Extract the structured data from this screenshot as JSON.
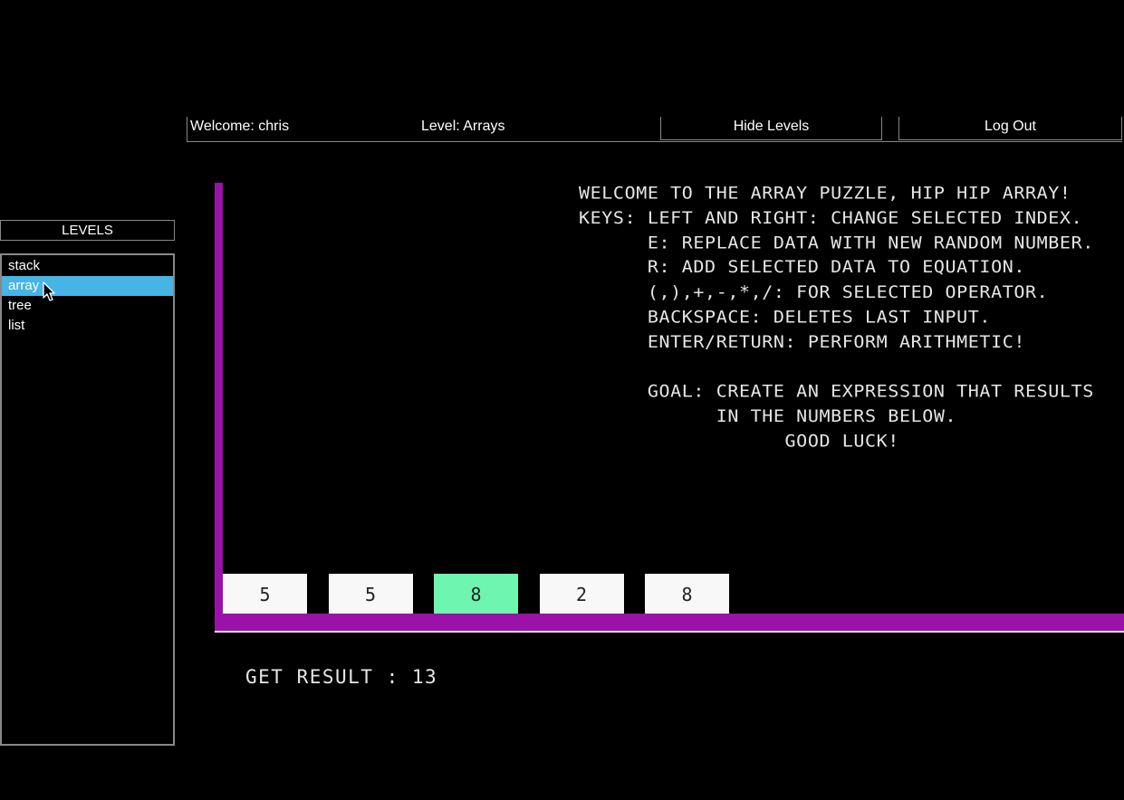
{
  "header": {
    "welcome": "Welcome: chris",
    "level": "Level: Arrays",
    "hide_levels_label": "Hide Levels",
    "logout_label": "Log Out"
  },
  "sidebar": {
    "title": "LEVELS",
    "items": [
      {
        "label": "stack",
        "selected": false
      },
      {
        "label": "array",
        "selected": true
      },
      {
        "label": "tree",
        "selected": false
      },
      {
        "label": "list",
        "selected": false
      }
    ]
  },
  "game": {
    "instructions": [
      "WELCOME TO THE ARRAY PUZZLE, HIP HIP ARRAY!",
      "KEYS: LEFT AND RIGHT: CHANGE SELECTED INDEX.",
      "      E: REPLACE DATA WITH NEW RANDOM NUMBER.",
      "      R: ADD SELECTED DATA TO EQUATION.",
      "      (,),+,-,*,/: FOR SELECTED OPERATOR.",
      "      BACKSPACE: DELETES LAST INPUT.",
      "      ENTER/RETURN: PERFORM ARITHMETIC!",
      "",
      "      GOAL: CREATE AN EXPRESSION THAT RESULTS",
      "            IN THE NUMBERS BELOW.",
      "                  GOOD LUCK!"
    ],
    "array": [
      5,
      5,
      8,
      2,
      8
    ],
    "selected_index": 2,
    "result_text": "GET RESULT : 13"
  },
  "colors": {
    "wall": "#9a12a8",
    "cell": "#f8f8f8",
    "cell_selected": "#6ef5b0",
    "sidebar_selected": "#46b4e4"
  }
}
